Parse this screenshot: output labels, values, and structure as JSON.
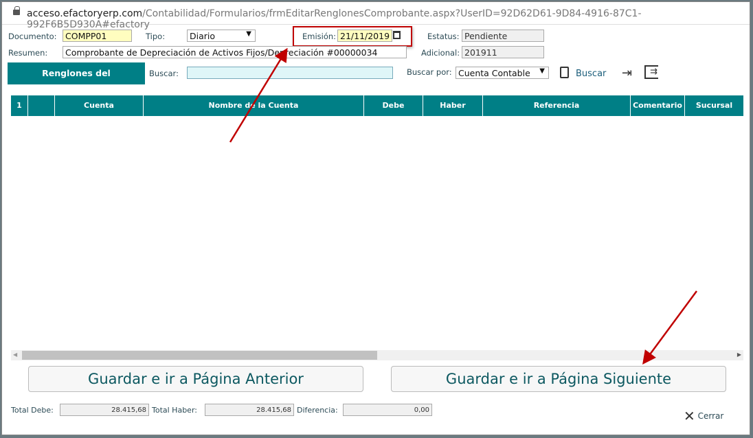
{
  "browser": {
    "url_host": "acceso.efactoryerp.com",
    "url_path": "/Contabilidad/Formularios/frmEditarRenglonesComprobante.aspx?UserID=92D62D61-9D84-4916-87C1-992F6B5D930A#efactory"
  },
  "form": {
    "documento_label": "Documento:",
    "documento": "COMPP01",
    "tipo_label": "Tipo:",
    "tipo": "Diario",
    "emision_label": "Emisión:",
    "emision": "21/11/2019",
    "estatus_label": "Estatus:",
    "estatus": "Pendiente",
    "resumen_label": "Resumen:",
    "resumen": "Comprobante de Depreciación de Activos Fijos/Depreciación #00000034",
    "adicional_label": "Adicional:",
    "adicional": "201911"
  },
  "toolbar": {
    "section_label": "Renglones del Comprobante:",
    "buscar_label": "Buscar:",
    "buscar_value": "",
    "buscar_por_label": "Buscar por:",
    "buscar_por": "Cuenta Contable",
    "buscar_button": "Buscar"
  },
  "grid": {
    "columns": [
      "1",
      "",
      "Cuenta",
      "Nombre de la Cuenta",
      "Debe",
      "Haber",
      "Referencia",
      "Comentario",
      "Sucursal"
    ],
    "scroll_fraction": 0.49
  },
  "buttons": {
    "prev": "Guardar e ir a Página Anterior",
    "next": "Guardar e ir a Página Siguiente",
    "close": "Cerrar"
  },
  "totals": {
    "debe_label": "Total Debe:",
    "debe": "28.415,68",
    "haber_label": "Total Haber:",
    "haber": "28.415,68",
    "dif_label": "Diferencia:",
    "dif": "0,00"
  },
  "colors": {
    "accent": "#007f86",
    "annotation": "#c00000"
  }
}
